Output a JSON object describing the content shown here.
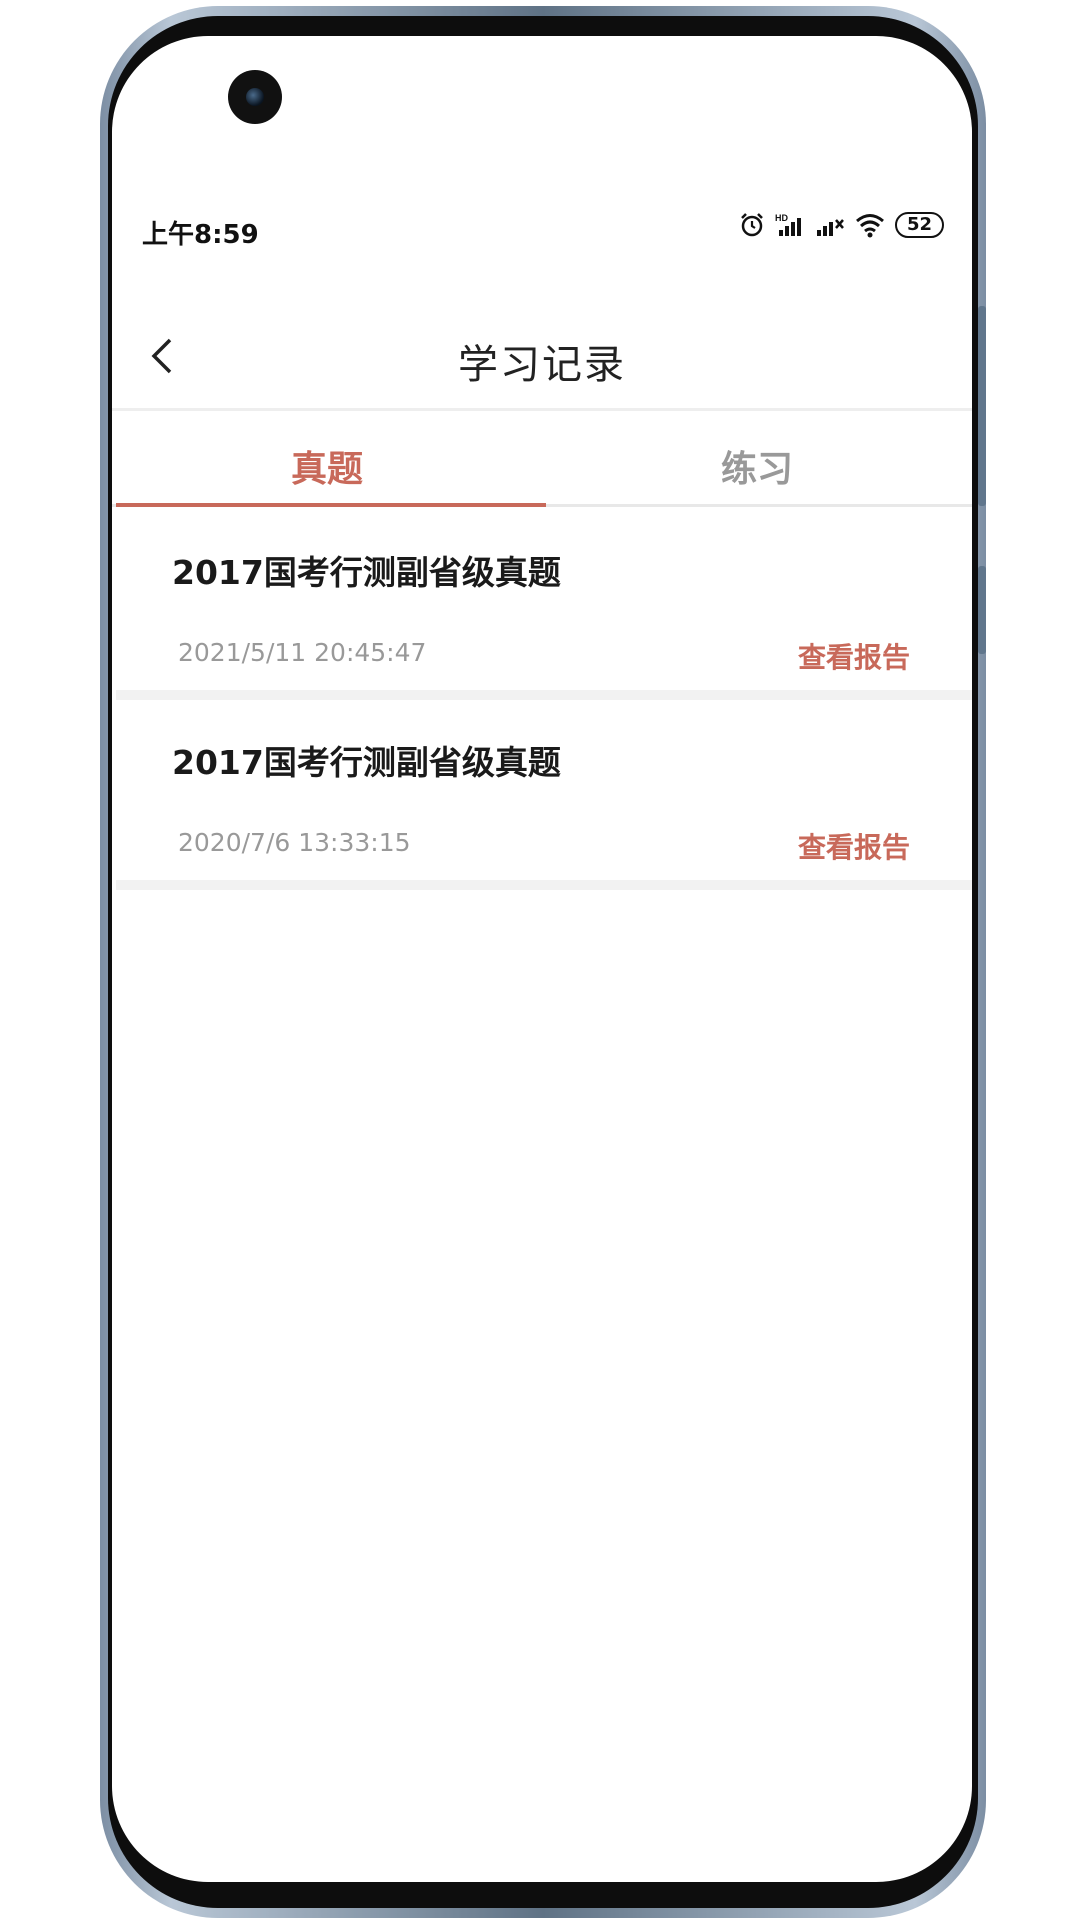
{
  "status_bar": {
    "time": "上午8:59",
    "icons": [
      "alarm-icon",
      "hd-signal-icon",
      "signal-icon",
      "wifi-icon"
    ],
    "battery": "52"
  },
  "header": {
    "back_icon": "chevron-left-icon",
    "title": "学习记录"
  },
  "tabs": [
    {
      "label": "真题",
      "active": true
    },
    {
      "label": "练习",
      "active": false
    }
  ],
  "records": [
    {
      "title": "2017国考行测副省级真题",
      "time": "2021/5/11  20:45:47",
      "action": "查看报告"
    },
    {
      "title": "2017国考行测副省级真题",
      "time": "2020/7/6  13:33:15",
      "action": "查看报告"
    }
  ],
  "colors": {
    "accent": "#c8695a",
    "inactive": "#999999",
    "text": "#1a1a1a"
  }
}
